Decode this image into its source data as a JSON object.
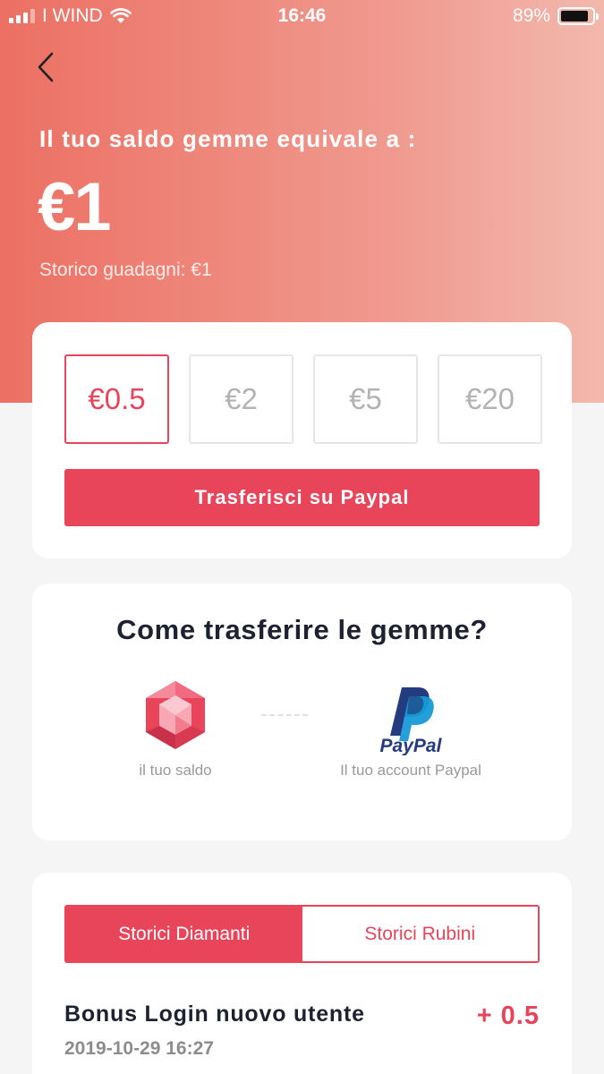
{
  "status_bar": {
    "carrier": "I WIND",
    "time": "16:46",
    "battery_percent": "89%",
    "battery_level": 0.89,
    "icons": [
      "signal-icon",
      "wifi-icon",
      "battery-icon"
    ]
  },
  "header": {
    "back_icon": "chevron-left-icon",
    "title": "Il tuo saldo gemme equivale a :",
    "balance": "€1",
    "history": "Storico guadagni: €1"
  },
  "withdraw": {
    "options": [
      "€0.5",
      "€2",
      "€5",
      "€20"
    ],
    "selected": "€0.5",
    "button_label": "Trasferisci su Paypal"
  },
  "how_to": {
    "title": "Come trasferire le gemme?",
    "from_label": "il tuo saldo",
    "from_icon": "gem-icon",
    "to_label": "Il tuo account Paypal",
    "to_icon": "paypal-icon",
    "paypal_wordmark": "PayPal"
  },
  "history_section": {
    "tabs": [
      {
        "label": "Storici Diamanti",
        "active": true
      },
      {
        "label": "Storici Rubini",
        "active": false
      }
    ],
    "transactions": [
      {
        "title": "Bonus Login nuovo utente",
        "date": "2019-10-29 16:27",
        "amount": "+ 0.5"
      }
    ]
  },
  "colors": {
    "accent": "#e8445a",
    "hero_start": "#ec7063",
    "hero_end": "#f3b8ad",
    "paypal_dark": "#253b80",
    "paypal_light": "#179bd7"
  }
}
